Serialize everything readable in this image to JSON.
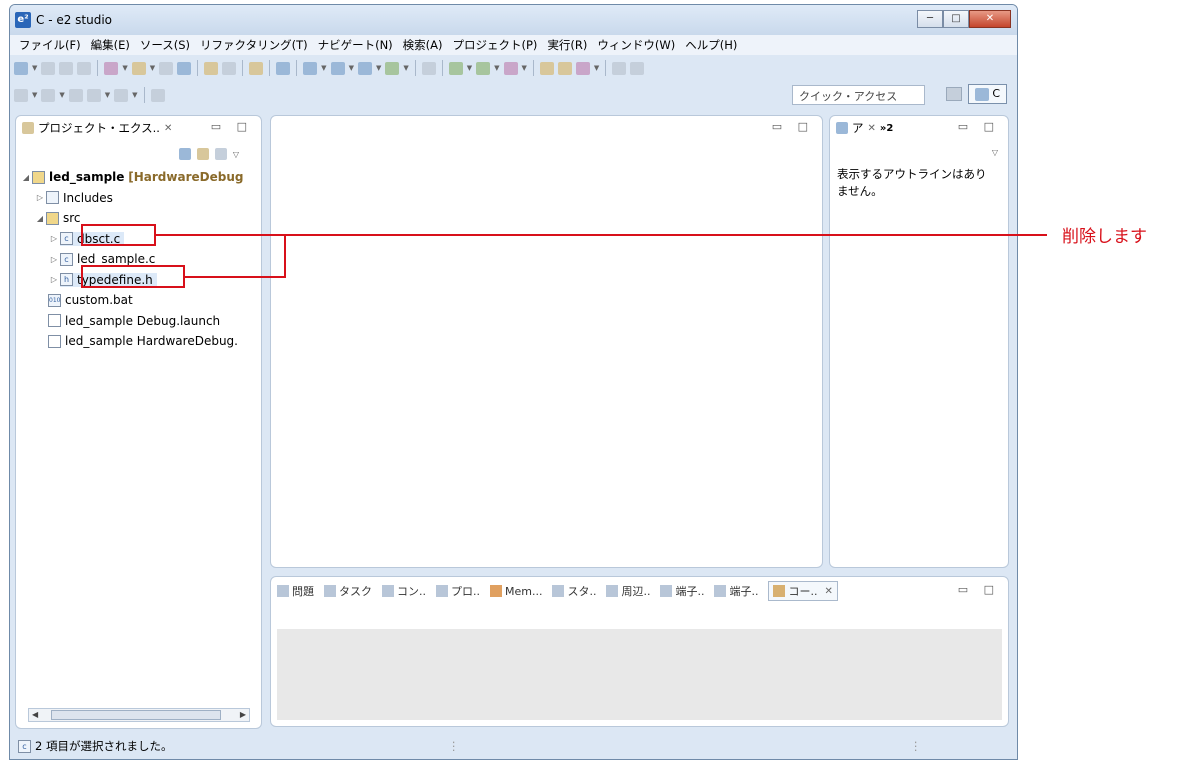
{
  "window": {
    "title": "C - e2 studio",
    "app_icon": "e²",
    "minimize": "─",
    "maximize": "□",
    "close": "✕"
  },
  "menu": [
    "ファイル(F)",
    "編集(E)",
    "ソース(S)",
    "リファクタリング(T)",
    "ナビゲート(N)",
    "検索(A)",
    "プロジェクト(P)",
    "実行(R)",
    "ウィンドウ(W)",
    "ヘルプ(H)"
  ],
  "toolbar": {
    "quick_access_placeholder": "クイック・アクセス",
    "perspective_label": "C"
  },
  "project_explorer": {
    "tab_label": "プロジェクト・エクス..",
    "tree": [
      {
        "label": "led_sample",
        "config": "[HardwareDebug",
        "icon": "project-icon",
        "twisty": "◢"
      },
      {
        "label": "Includes",
        "icon": "includes-icon",
        "twisty": "▷"
      },
      {
        "label": "src",
        "icon": "folder-icon",
        "twisty": "◢"
      },
      {
        "label": "dbsct.c",
        "icon": "c-file-icon",
        "twisty": "▷",
        "glyph": "c",
        "selected": true
      },
      {
        "label": "led_sample.c",
        "icon": "c-file-icon",
        "twisty": "▷",
        "glyph": "c"
      },
      {
        "label": "typedefine.h",
        "icon": "h-file-icon",
        "twisty": "▷",
        "glyph": "h",
        "selected": true
      },
      {
        "label": "custom.bat",
        "icon": "bat-file-icon",
        "glyph": "010"
      },
      {
        "label": "led_sample Debug.launch",
        "icon": "launch-file-icon"
      },
      {
        "label": "led_sample HardwareDebug.",
        "icon": "launch-file-icon"
      }
    ]
  },
  "outline": {
    "tab_label": "ア",
    "overflow": "»2",
    "message_line1": "表示するアウトラインはあり",
    "message_line2": "ません。"
  },
  "bottom_tabs": [
    "問題",
    "タスク",
    "コン..",
    "プロ..",
    "Mem...",
    "スタ..",
    "周辺..",
    "端子..",
    "端子..",
    "コー.."
  ],
  "status": {
    "text": "2 項目が選択されました。"
  },
  "annotation": {
    "callout": "削除します",
    "color": "#d8101a"
  }
}
